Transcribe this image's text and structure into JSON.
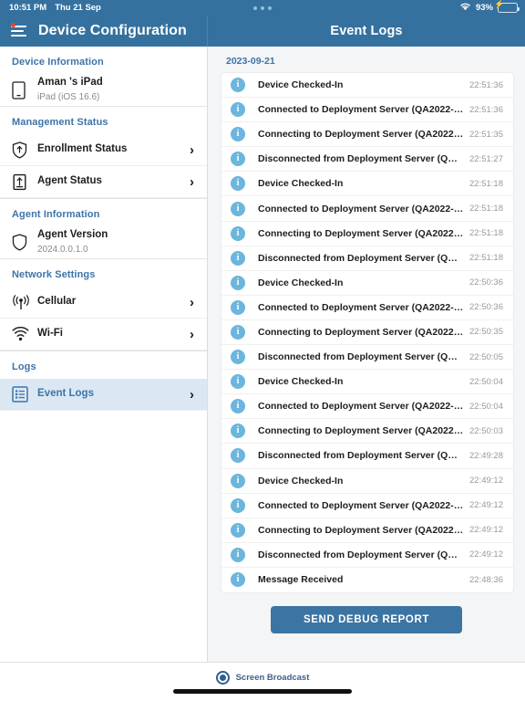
{
  "status_bar": {
    "time": "10:51 PM",
    "date": "Thu 21 Sep",
    "multitask_icon": "three-dots-icon",
    "wifi_icon": "wifi-icon",
    "battery_percent": "93%",
    "battery_icon": "battery-charging-icon",
    "bolt_glyph": "⚡"
  },
  "header": {
    "menu_icon": "hamburger-menu-icon",
    "left_title": "Device Configuration",
    "right_title": "Event Logs",
    "badge_color": "#e8433a",
    "bar_color": "#35719f"
  },
  "sidebar": {
    "sections": [
      {
        "title": "Device Information",
        "items": [
          {
            "icon": "tablet-icon",
            "label": "Aman 's iPad",
            "sub": "iPad (iOS 16.6)",
            "chevron": false,
            "selected": false
          }
        ]
      },
      {
        "title": "Management Status",
        "items": [
          {
            "icon": "shield-up-arrow-icon",
            "label": "Enrollment Status",
            "sub": "",
            "chevron": true,
            "selected": false
          },
          {
            "icon": "box-up-arrow-icon",
            "label": "Agent Status",
            "sub": "",
            "chevron": true,
            "selected": false
          }
        ]
      },
      {
        "title": "Agent Information",
        "items": [
          {
            "icon": "shield-icon",
            "label": "Agent Version",
            "sub": "2024.0.0.1.0",
            "chevron": false,
            "selected": false
          }
        ]
      },
      {
        "title": "Network Settings",
        "items": [
          {
            "icon": "cellular-icon",
            "label": "Cellular",
            "sub": "",
            "chevron": true,
            "selected": false
          },
          {
            "icon": "wifi-icon",
            "label": "Wi-Fi",
            "sub": "",
            "chevron": true,
            "selected": false
          }
        ]
      },
      {
        "title": "Logs",
        "items": [
          {
            "icon": "list-icon",
            "label": "Event Logs",
            "sub": "",
            "chevron": true,
            "selected": true
          }
        ]
      }
    ],
    "chevron_glyph": "›",
    "section_color": "#3d74a8",
    "selected_bg": "#dbe8f3"
  },
  "event_logs": {
    "date_header": "2023-09-21",
    "entries": [
      {
        "icon": "info-icon",
        "message": "Device Checked-In",
        "time": "22:51:36"
      },
      {
        "icon": "info-icon",
        "message": "Connected to Deployment Server (QA2022-…",
        "time": "22:51:36"
      },
      {
        "icon": "info-icon",
        "message": "Connecting to Deployment Server (QA2022…",
        "time": "22:51:35"
      },
      {
        "icon": "info-icon",
        "message": "Disconnected from Deployment Server (QA…",
        "time": "22:51:27"
      },
      {
        "icon": "info-icon",
        "message": "Device Checked-In",
        "time": "22:51:18"
      },
      {
        "icon": "info-icon",
        "message": "Connected to Deployment Server (QA2022-…",
        "time": "22:51:18"
      },
      {
        "icon": "info-icon",
        "message": "Connecting to Deployment Server (QA2022…",
        "time": "22:51:18"
      },
      {
        "icon": "info-icon",
        "message": "Disconnected from Deployment Server (QA…",
        "time": "22:51:18"
      },
      {
        "icon": "info-icon",
        "message": "Device Checked-In",
        "time": "22:50:36"
      },
      {
        "icon": "info-icon",
        "message": "Connected to Deployment Server (QA2022-…",
        "time": "22:50:36"
      },
      {
        "icon": "info-icon",
        "message": "Connecting to Deployment Server (QA2022…",
        "time": "22:50:35"
      },
      {
        "icon": "info-icon",
        "message": "Disconnected from Deployment Server (QA…",
        "time": "22:50:05"
      },
      {
        "icon": "info-icon",
        "message": "Device Checked-In",
        "time": "22:50:04"
      },
      {
        "icon": "info-icon",
        "message": "Connected to Deployment Server (QA2022-…",
        "time": "22:50:04"
      },
      {
        "icon": "info-icon",
        "message": "Connecting to Deployment Server (QA2022…",
        "time": "22:50:03"
      },
      {
        "icon": "info-icon",
        "message": "Disconnected from Deployment Server (QA…",
        "time": "22:49:28"
      },
      {
        "icon": "info-icon",
        "message": "Device Checked-In",
        "time": "22:49:12"
      },
      {
        "icon": "info-icon",
        "message": "Connected to Deployment Server (QA2022-…",
        "time": "22:49:12"
      },
      {
        "icon": "info-icon",
        "message": "Connecting to Deployment Server (QA2022…",
        "time": "22:49:12"
      },
      {
        "icon": "info-icon",
        "message": "Disconnected from Deployment Server (QA…",
        "time": "22:49:12"
      },
      {
        "icon": "info-icon",
        "message": "Message Received",
        "time": "22:48:36"
      }
    ],
    "send_debug_label": "SEND DEBUG REPORT",
    "button_color": "#3c74a3"
  },
  "bottom_bar": {
    "broadcast_icon": "screen-broadcast-icon",
    "broadcast_label": "Screen Broadcast",
    "home_indicator": "home-indicator"
  }
}
